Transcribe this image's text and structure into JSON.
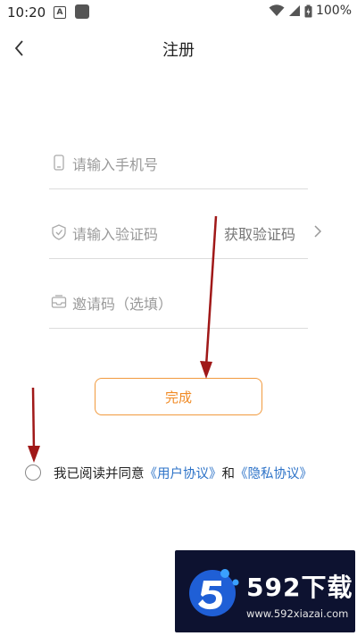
{
  "status_bar": {
    "time": "10:20",
    "app_indicator": "A",
    "battery": "100%",
    "icons": [
      "wifi-icon",
      "signal-icon",
      "battery-charging-icon"
    ]
  },
  "header": {
    "title": "注册",
    "back_icon": "chevron-left-icon"
  },
  "form": {
    "phone_placeholder": "请输入手机号",
    "code_placeholder": "请输入验证码",
    "get_code_label": "获取验证码",
    "invite_placeholder": "邀请码（选填）"
  },
  "submit_label": "完成",
  "agreement": {
    "prefix": "我已阅读并同意",
    "user_agreement": "《用户协议》",
    "and": "和",
    "privacy_policy": "《隐私协议》"
  },
  "colors": {
    "accent": "#f08a24",
    "link": "#2d73c8",
    "annotation_arrow": "#a01818",
    "watermark_bg": "#0d1230"
  },
  "watermark": {
    "brand": "592下载",
    "url": "www.592xiazai.com"
  }
}
